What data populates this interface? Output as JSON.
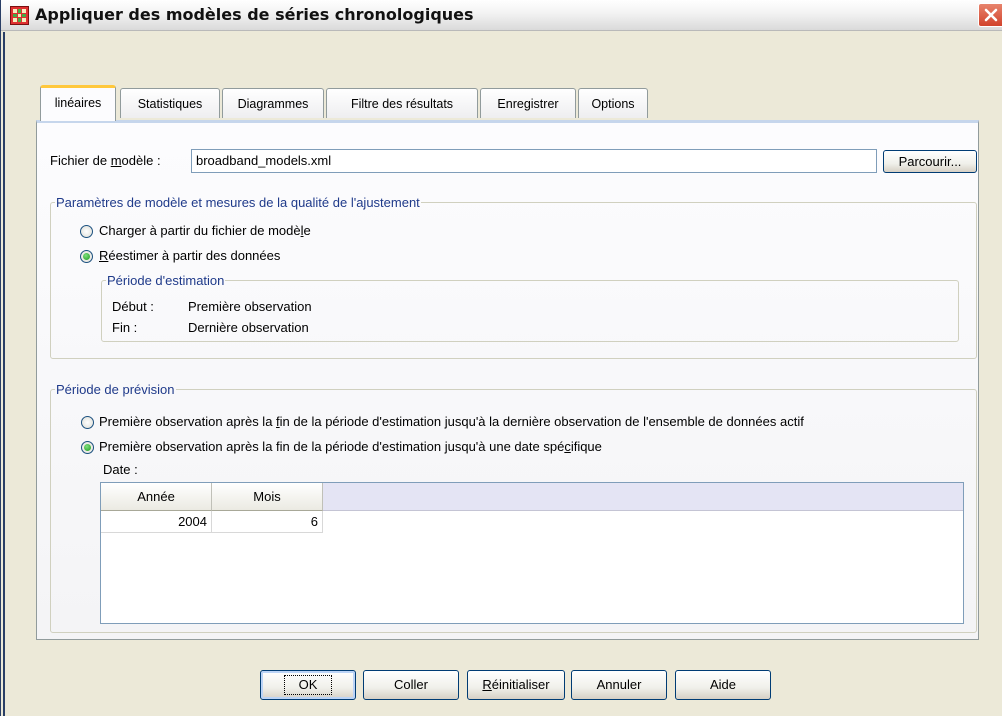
{
  "window": {
    "title": "Appliquer des modèles de séries chronologiques"
  },
  "tabs": [
    {
      "label": "linéaires",
      "active": true
    },
    {
      "label": "Statistiques"
    },
    {
      "label": "Diagrammes"
    },
    {
      "label": "Filtre des résultats"
    },
    {
      "label": "Enregistrer"
    },
    {
      "label": "Options"
    }
  ],
  "model_file": {
    "label_prefix": "Fichier de ",
    "label_mnemonic": "m",
    "label_suffix": "odèle :",
    "value": "broadband_models.xml",
    "browse_label": "Parcourir..."
  },
  "params_group": {
    "legend": "Paramètres de modèle et mesures de la qualité de l'ajustement",
    "radio_load": {
      "pre": "Charger à partir du fichier de modè",
      "mn": "l",
      "post": "e",
      "checked": false
    },
    "radio_reestimate": {
      "pre": "",
      "mn": "R",
      "post": "éestimer à partir des données",
      "checked": true
    },
    "estimation": {
      "legend": "Période d'estimation",
      "start_label": "Début :",
      "start_value": "Première observation",
      "end_label": "Fin :",
      "end_value": "Dernière observation"
    }
  },
  "forecast_group": {
    "legend": "Période de prévision",
    "radio_active": {
      "pre": "Première observation après la ",
      "mn": "f",
      "post": "in de la période d'estimation jusqu'à la dernière observation de l'ensemble de données actif",
      "checked": false
    },
    "radio_specific": {
      "pre": "Première observation après la fin de la période d'estimation jusqu'à une date spé",
      "mn": "c",
      "post": "ifique",
      "checked": true
    },
    "date_label": "Date :",
    "grid": {
      "columns": [
        "Année",
        "Mois"
      ],
      "rows": [
        [
          "2004",
          "6"
        ]
      ]
    }
  },
  "buttons": {
    "ok": "OK",
    "paste": "Coller",
    "reset_mn": "R",
    "reset_rest": "éinitialiser",
    "cancel": "Annuler",
    "help": "Aide"
  },
  "colors": {
    "legend_text": "#1f3a8a",
    "active_tab_accent": "#ffc83c",
    "close_button": "#d2432c",
    "dialog_bg": "#ece9d8"
  }
}
